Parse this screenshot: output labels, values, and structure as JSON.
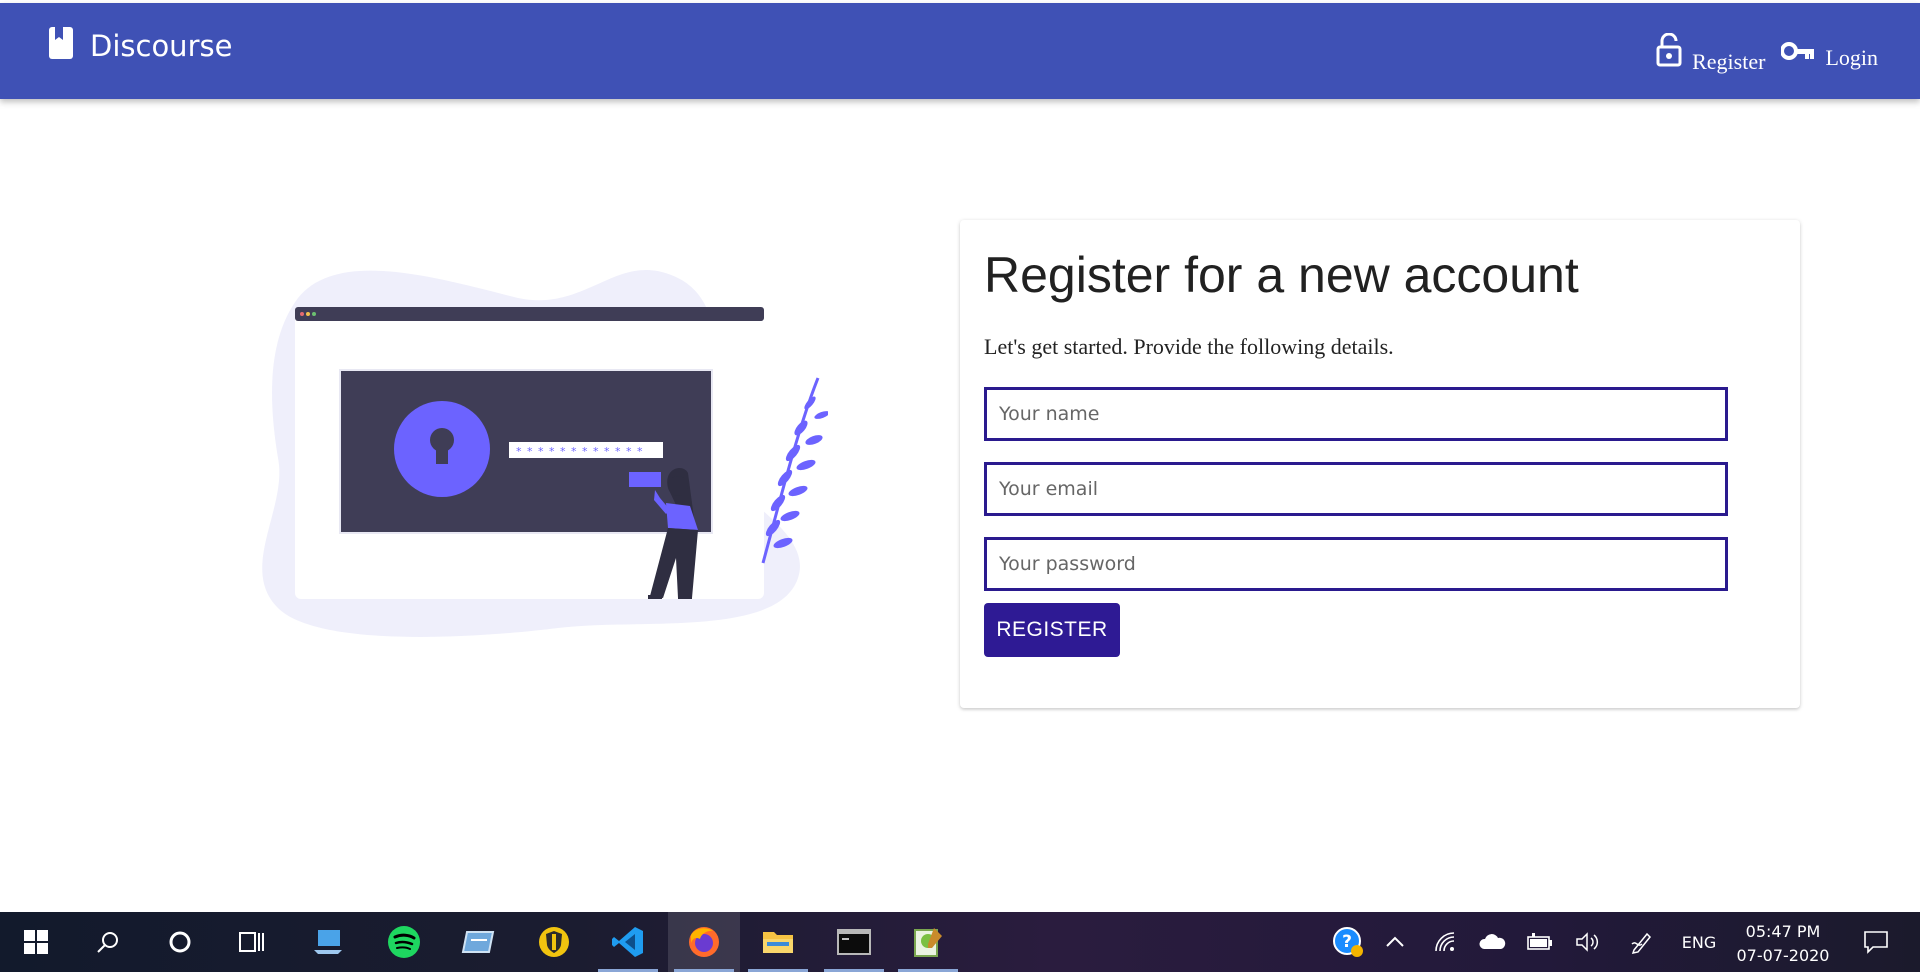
{
  "app": {
    "brand": "Discourse",
    "nav": {
      "register": "Register",
      "login": "Login"
    }
  },
  "form": {
    "title": "Register for a new account",
    "subtitle": "Let's get started. Provide the following details.",
    "name_placeholder": "Your name",
    "email_placeholder": "Your email",
    "password_placeholder": "Your password",
    "submit_label": "REGISTER"
  },
  "colors": {
    "navbar": "#3f51b5",
    "button": "#2e1a94",
    "input_border": "#2a1a8e",
    "illustration_accent": "#6c63ff",
    "illustration_dark": "#3f3d56"
  },
  "taskbar": {
    "apps": [
      "windows-start",
      "search",
      "cortana",
      "task-view",
      "this-pc",
      "spotify",
      "sticky-app",
      "security-shield",
      "vscode",
      "firefox",
      "file-explorer",
      "terminal",
      "notepad-plus"
    ],
    "active_app": "firefox",
    "tray": {
      "language": "ENG",
      "time": "05:47 PM",
      "date": "07-07-2020"
    }
  }
}
